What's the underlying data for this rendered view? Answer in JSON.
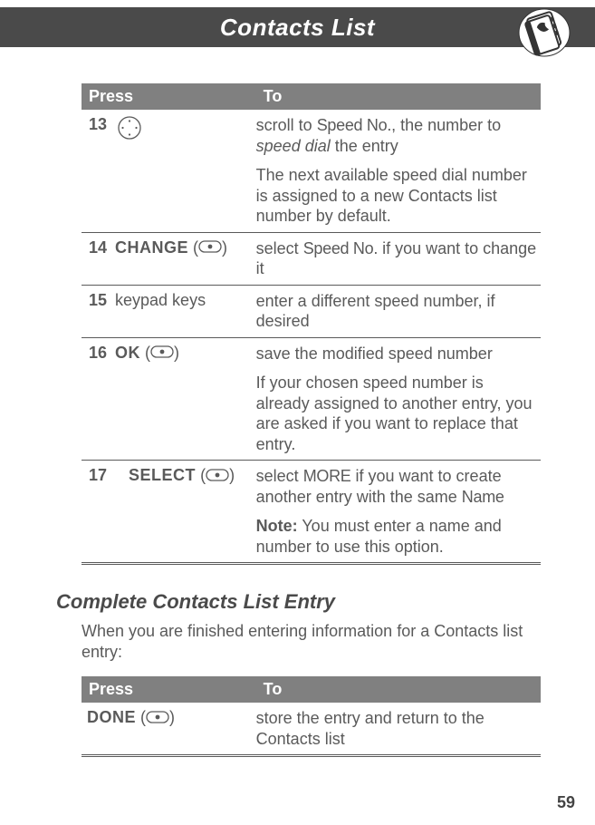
{
  "header": {
    "title": "Contacts List"
  },
  "table1": {
    "head": {
      "press": "Press",
      "to": "To"
    },
    "rows": [
      {
        "num": "13",
        "press_kind": "nav",
        "to": [
          {
            "pre": "scroll to ",
            "mono": "Speed No.",
            "post": ", the number to ",
            "italic": "speed dial",
            "post2": " the entry"
          },
          {
            "plain": "The next available speed dial number is assigned to a new Contacts list number by default."
          }
        ]
      },
      {
        "num": "14",
        "press_soft": "CHANGE",
        "press_kind": "soft",
        "to": [
          {
            "pre": "select ",
            "mono": "Speed No.",
            "post": " if you want to change it"
          }
        ]
      },
      {
        "num": "15",
        "press_text": "keypad keys",
        "press_kind": "text",
        "to": [
          {
            "plain": "enter a different speed number, if desired"
          }
        ]
      },
      {
        "num": "16",
        "press_soft": "OK",
        "press_kind": "soft",
        "to": [
          {
            "plain": "save the modified speed number"
          },
          {
            "plain": "If your chosen speed number is already assigned to another entry, you are asked if you want to replace that entry."
          }
        ]
      },
      {
        "num": "17",
        "press_soft": "SELECT",
        "press_kind": "soft",
        "indent": true,
        "to": [
          {
            "pre": "select ",
            "mono": "MORE",
            "post": " if you want to create another entry with the same ",
            "mono2": "Name"
          },
          {
            "bold": "Note:",
            "post": " You must enter a name and number to use this option."
          }
        ]
      }
    ]
  },
  "section": {
    "heading": "Complete Contacts List Entry",
    "para": "When you are finished entering information for a Contacts list entry:"
  },
  "table2": {
    "head": {
      "press": "Press",
      "to": "To"
    },
    "row": {
      "press_soft": "DONE",
      "to": "store the entry and return to the Contacts list"
    }
  },
  "page_number": "59"
}
